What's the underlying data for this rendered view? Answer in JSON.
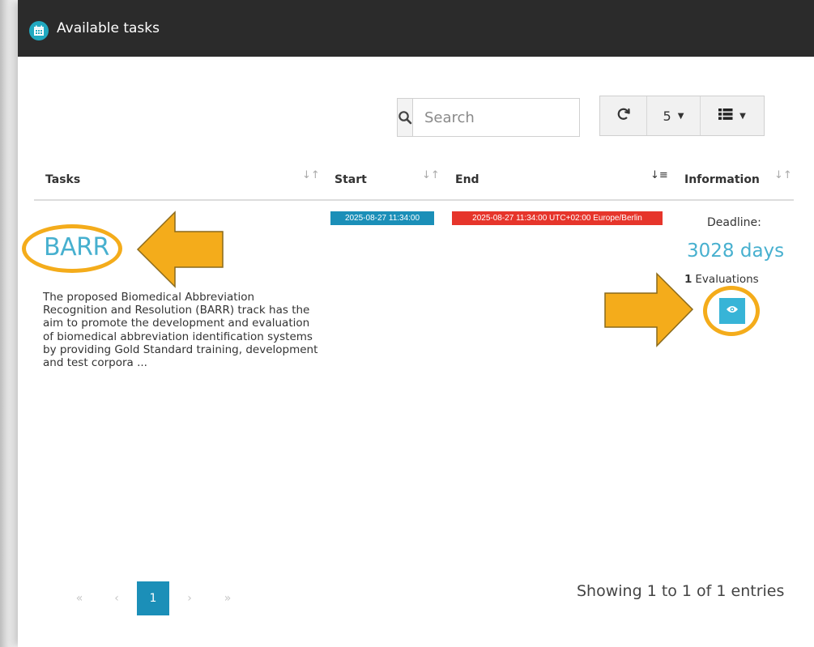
{
  "window": {
    "title": "Available tasks",
    "icon": "calendar-icon"
  },
  "toolbar": {
    "search_placeholder": "Search",
    "page_size": "5",
    "refresh_icon": "refresh-icon",
    "columns_icon": "columns-list-icon"
  },
  "table": {
    "columns": [
      "Tasks",
      "Start",
      "End",
      "Information"
    ],
    "rows": [
      {
        "title": "BARR",
        "description": "The proposed Biomedical Abbreviation Recognition and Resolution (BARR) track has the aim to promote the development and evaluation of biomedical abbreviation identification systems by providing Gold Standard training, development and test corpora ...",
        "start": "2025-08-27 11:34:00",
        "end": "2025-08-27 11:34:00 UTC+02:00 Europe/Berlin",
        "deadline_label": "Deadline:",
        "deadline_value": "3028 days",
        "evaluations_count": "1",
        "evaluations_label": "Evaluations"
      }
    ]
  },
  "pagination": {
    "first": "«",
    "prev": "‹",
    "current": "1",
    "next": "›",
    "last": "»",
    "summary": "Showing 1 to 1 of 1 entries"
  },
  "colors": {
    "header_bg": "#2b2b2b",
    "accent": "#47b0cf",
    "start_label": "#1b8fb8",
    "end_label": "#e6352b",
    "highlight": "#f4ac1b"
  }
}
